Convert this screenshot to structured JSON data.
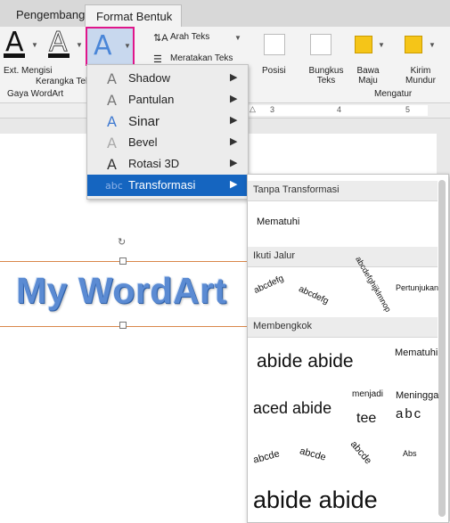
{
  "tabs": {
    "inactive": "Pengembang",
    "active": "Format Bentuk"
  },
  "ribbon": {
    "text_fill_label": "Ext. Mengisi",
    "text_outline_label": "Kerangka Teks",
    "wordart_group_label": "Gaya WordArt",
    "text_direction_label": "Arah Teks",
    "align_text_label": "Meratakan Teks",
    "position_label": "Posisi",
    "wrap_text_label": "Bungkus Teks",
    "bring_forward_label": "Bawa Maju",
    "send_backward_label": "Kirim Mundur",
    "arrange_group_label": "Mengatur",
    "letter_a": "A"
  },
  "ruler": {
    "marks": [
      "3",
      "4",
      "5"
    ]
  },
  "document": {
    "wordart_text": "My WordArt"
  },
  "effects_menu": {
    "items": [
      {
        "label": "Shadow",
        "icon": "A"
      },
      {
        "label": "Pantulan",
        "icon": "A"
      },
      {
        "label": "Sinar",
        "icon": "A"
      },
      {
        "label": "Bevel",
        "icon": "A"
      },
      {
        "label": "Rotasi 3D",
        "icon": "A"
      },
      {
        "label": "Transformasi",
        "icon": "abc"
      }
    ],
    "arrow": "▶"
  },
  "transform_gallery": {
    "no_transform_header": "Tanpa Transformasi",
    "no_transform_item": "Mematuhi",
    "follow_path_header": "Ikuti Jalur",
    "follow_path_items": [
      "abcdefg",
      "abcdefg",
      "abcdefghijklmnop",
      "Pertunjukan"
    ],
    "warp_header": "Membengkok",
    "warp_items": [
      "abide abide",
      "Mematuhi",
      "aced abide",
      "menjadi",
      "tee",
      "Meninggal",
      "abc",
      "abcde",
      "abcde",
      "abcde",
      "Abs",
      "abide abide"
    ]
  },
  "colors": {
    "accent": "#1565c0",
    "highlight_border": "#e0168a",
    "wordart_fill": "#5b8bd3"
  }
}
